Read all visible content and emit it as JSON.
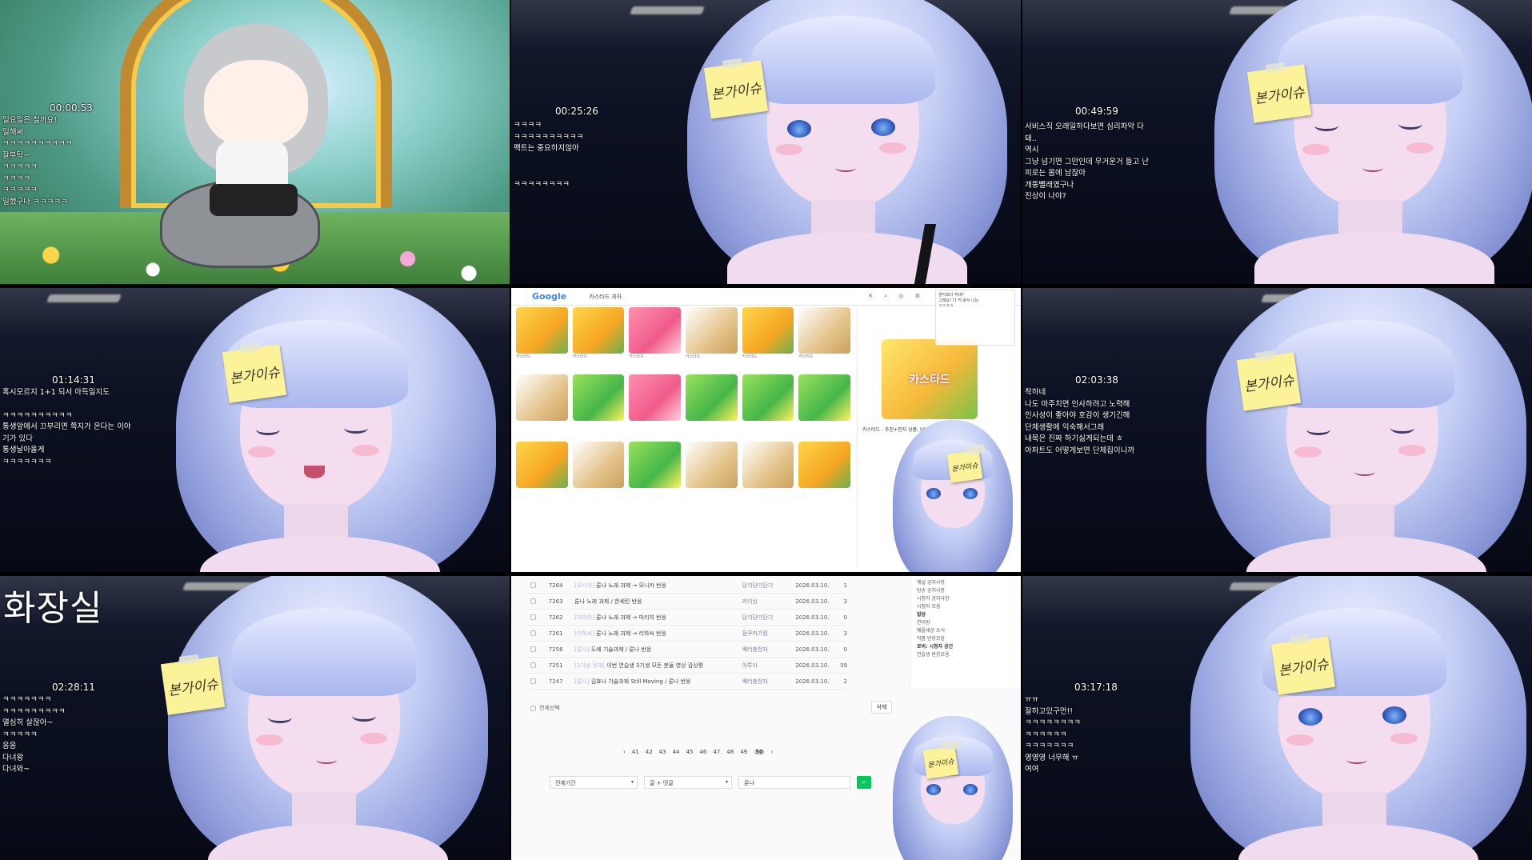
{
  "tiles": {
    "t1": {
      "time": "00:00:53",
      "chat": [
        "일요일은 칠까요!",
        "일해써",
        "ㅋㅋㅋㅋㅋㅋㅋㅋㅋㅋ",
        "잘부탁~",
        "ㅋㅋㅋㅋㅋ",
        "ㅋㅋㅋㅋ",
        "ㅋㅋㅋㅋㅋ",
        "일했구나 ㅋㅋㅋㅋㅋ"
      ]
    },
    "t2": {
      "time": "00:25:26",
      "chat": [
        "ㅋㅋㅋㅋ",
        "ㅋㅋㅋㅋㅋㅋㅋㅋㅋㅋ",
        "팩트는 중요하지않아",
        "ㅋㅋㅋㅋㅋㅋㅋㅋ"
      ],
      "note": "본가이슈"
    },
    "t3": {
      "time": "00:49:59",
      "chat": [
        "서비스직 오래일하다보면 심리파악 다",
        "돼..",
        "역시",
        "그냥 넘기면 그만인데 무거운거 들고 난",
        "피로는 몸에 남잖아",
        "개뚱뻘래였구나",
        "진상이 나야?"
      ],
      "note": "본가이슈"
    },
    "t4": {
      "time": "01:14:31",
      "chat": [
        "혹시모르지 1+1 되서 아득일지도",
        "ㅋㅋㅋㅋㅋㅋㅋㅋㅋㅋ",
        "통생앞에서 끄부리면 쪽지가 온다는 이야",
        "기가 있다",
        "통생날아올게",
        "ㅋㅋㅋㅋㅋㅋㅋ"
      ],
      "note": "본가이슈"
    },
    "t5": {
      "search": {
        "logo": "Google",
        "query": "카스타드 과자",
        "icons": "✕ ⌕ ◎ ⚙"
      },
      "captions": [
        "카스타드",
        "카스타드",
        "카스타드",
        "카스타드",
        "카스타드",
        "카스타드"
      ],
      "side_title": "카스타드 - 추천+먼지 상품, SSG.COM",
      "side_img_text": "카스타드",
      "chat": [
        "생각보다 작네?",
        "그래요? 다 커 봐서 나는",
        "ㅋㅋㅋㅋ"
      ],
      "note": "본가이슈"
    },
    "t6": {
      "time": "02:03:38",
      "chat": [
        "착하네",
        "나도 마주치면 인사하려고 노력해",
        "인사성이 좋아야 호감이 생기긴해",
        "단체생활에 익숙해서그래",
        "내목은 진짜 하기싫게되는데 ㅎ",
        "아파트도 어떻게보면 단체집이니까"
      ],
      "note": "본가이슈"
    },
    "t7": {
      "label": "화장실",
      "time": "02:28:11",
      "chat": [
        "ㅋㅋㅋㅋㅋㅋㅋ",
        "ㅋㅋㅋㅋㅋㅋㅋㅋㅋ",
        "열심히 살잖아~",
        "ㅋㅋㅋㅋㅋ",
        "응응",
        "다녀왕",
        "다녀와~"
      ],
      "note": "본가이슈"
    },
    "t8": {
      "rows": [
        {
          "num": "7264",
          "tag": "[모니카]",
          "title": "룬나 노래 과제 → 모니카 반응",
          "author": "단기단기단기",
          "date": "2026.03.10.",
          "views": "1"
        },
        {
          "num": "7263",
          "tag": "",
          "title": "룬나 노래 과제 / 한세린 반응",
          "author": "카이신",
          "date": "2026.03.10.",
          "views": "3"
        },
        {
          "num": "7262",
          "tag": "[마리아]",
          "title": "룬나 노래 과제 → 마리히 반응",
          "author": "단기단기단기",
          "date": "2026.03.10.",
          "views": "0"
        },
        {
          "num": "7261",
          "tag": "[리하씨]",
          "title": "룬나 노래 과제 → 리하씨 반응",
          "author": "잠꾸러기킹",
          "date": "2026.03.10.",
          "views": "3"
        },
        {
          "num": "7256",
          "tag": "[룬나]",
          "title": "도예 기술과제 / 룬나 반응",
          "author": "배터충전자",
          "date": "2026.03.10.",
          "views": "0"
        },
        {
          "num": "7251",
          "tag": "[3기생 전체]",
          "title": "이번 연습생 3기생 모든 분들 영상 감상평",
          "author": "아루아",
          "date": "2026.03.10.",
          "views": "59"
        },
        {
          "num": "7247",
          "tag": "[룬나]",
          "title": "김효나 기술과제 Still Moving / 룬나 반응",
          "author": "배터충전자",
          "date": "2026.03.10.",
          "views": "2"
        }
      ],
      "select_all": "전체선택",
      "delete": "삭제",
      "pages": [
        "‹",
        "41",
        "42",
        "43",
        "44",
        "45",
        "46",
        "47",
        "48",
        "49",
        "50",
        "›"
      ],
      "current_page": "50",
      "search_period": "전체기간",
      "search_type": "글 + 댓글",
      "search_value": "룬나",
      "sidebar": [
        "채널 공지사항",
        "방송 공지사항",
        "시청자 공지사항",
        "시청자 모음",
        "잡담",
        "연어방",
        "애플세상 소식",
        "작품 반응모음",
        "로비: 시청자 공간",
        "연습생 반응모음"
      ],
      "note": "본가이슈"
    },
    "t9": {
      "time": "03:17:18",
      "chat": [
        "ㅠㅠ",
        "잘하고있구먼!!",
        "ㅋㅋㅋㅋㅋㅋㅋㅋ",
        "ㅋㅋㅋㅋㅋㅋ",
        "ㅋㅋㅋㅋㅋㅋㅋ",
        "영영영 너무해 ㅠ",
        "여여"
      ],
      "note": "본가이슈"
    }
  },
  "colors": {
    "note": "#fbf29a",
    "hair": "#aab7ee",
    "search_button": "#03c75a"
  }
}
